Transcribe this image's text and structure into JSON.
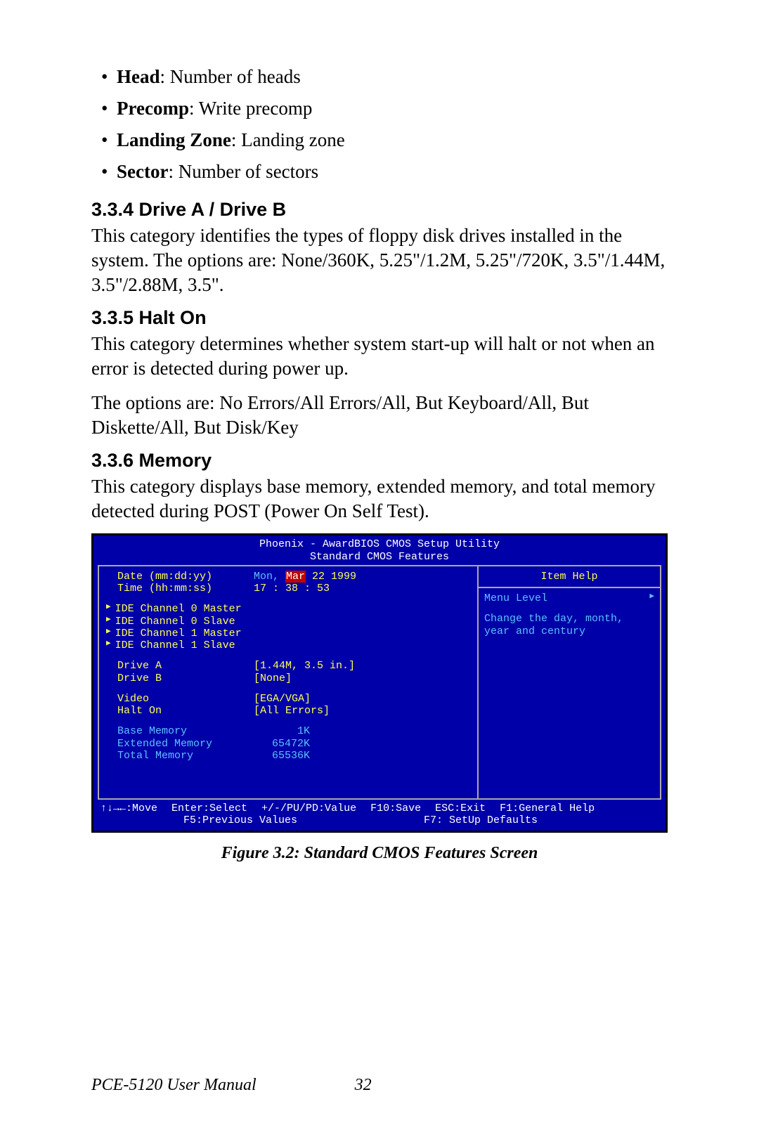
{
  "bullets": [
    {
      "term": "Head",
      "desc": ": Number of heads"
    },
    {
      "term": "Precomp",
      "desc": ": Write precomp"
    },
    {
      "term": "Landing Zone",
      "desc": ": Landing zone"
    },
    {
      "term": "Sector",
      "desc": ": Number of sectors"
    }
  ],
  "sections": {
    "s1": {
      "heading": "3.3.4 Drive A / Drive B",
      "p1": "This category identifies the types of floppy disk drives installed in the system. The options are: None/360K, 5.25\"/1.2M, 5.25\"/720K, 3.5\"/1.44M, 3.5\"/2.88M, 3.5\"."
    },
    "s2": {
      "heading": "3.3.5 Halt On",
      "p1": "This category determines whether system start-up will halt or not when an error is detected during power up.",
      "p2": "The options are: No Errors/All Errors/All, But Keyboard/All, But Diskette/All, But Disk/Key"
    },
    "s3": {
      "heading": "3.3.6 Memory",
      "p1": "This category displays base memory, extended memory, and total memory detected during POST (Power On Self Test)."
    }
  },
  "bios": {
    "title1": "Phoenix - AwardBIOS CMOS Setup Utility",
    "title2": "Standard CMOS Features",
    "date_label": "Date (mm:dd:yy)",
    "time_label": "Time (hh:mm:ss)",
    "date_dow": "Mon,",
    "date_sel": "Mar",
    "date_rest": " 22 1999",
    "time_value": "17 : 38 : 53",
    "ide": [
      "IDE Channel 0 Master",
      "IDE Channel 0 Slave",
      "IDE Channel 1 Master",
      "IDE Channel 1 Slave"
    ],
    "drive_a_label": "Drive A",
    "drive_a_value": "[1.44M, 3.5 in.]",
    "drive_b_label": "Drive B",
    "drive_b_value": "[None]",
    "video_label": "Video",
    "video_value": "[EGA/VGA]",
    "halt_label": "Halt On",
    "halt_value": "[All Errors]",
    "base_label": "Base Memory",
    "base_value": "1K",
    "ext_label": "Extended Memory",
    "ext_value": "65472K",
    "tot_label": "Total Memory",
    "tot_value": "65536K",
    "help_header": "Item Help",
    "menu_level": "Menu Level",
    "help_text": "Change the day, month, year and century",
    "keys_row1_a": "↑↓→←:Move",
    "keys_row1_b": "Enter:Select",
    "keys_row1_c": "+/-/PU/PD:Value",
    "keys_row1_d": "F10:Save",
    "keys_row1_e": "ESC:Exit",
    "keys_row1_f": "F1:General Help",
    "keys_row2_a": "F5:Previous Values",
    "keys_row2_b": "F7: SetUp Defaults"
  },
  "figure_caption": "Figure 3.2: Standard CMOS Features Screen",
  "footer": {
    "manual": "PCE-5120 User Manual",
    "page": "32"
  }
}
